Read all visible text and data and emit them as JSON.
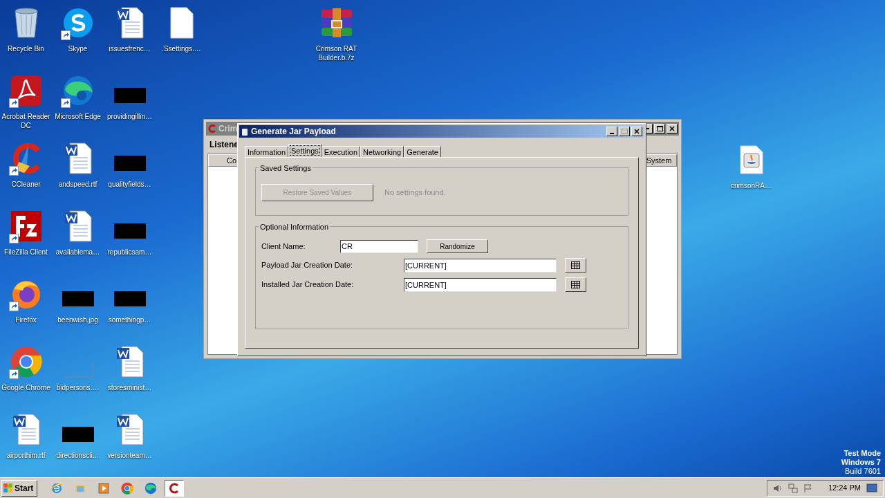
{
  "desktop": {
    "icons": [
      {
        "label": "Recycle Bin",
        "kind": "recycle",
        "shortcut": false
      },
      {
        "label": "Acrobat Reader DC",
        "kind": "pdf",
        "shortcut": true
      },
      {
        "label": "CCleaner",
        "kind": "ccleaner",
        "shortcut": true
      },
      {
        "label": "FileZilla Client",
        "kind": "filezilla",
        "shortcut": true
      },
      {
        "label": "Firefox",
        "kind": "firefox",
        "shortcut": true
      },
      {
        "label": "Google Chrome",
        "kind": "chrome",
        "shortcut": true
      },
      {
        "label": "airporthim.rtf",
        "kind": "word",
        "shortcut": false
      },
      {
        "label": "Skype",
        "kind": "skype",
        "shortcut": true
      },
      {
        "label": "Microsoft Edge",
        "kind": "edge",
        "shortcut": true
      },
      {
        "label": "andspeed.rtf",
        "kind": "word",
        "shortcut": false
      },
      {
        "label": "availablema…",
        "kind": "word",
        "shortcut": false
      },
      {
        "label": "beenwish.jpg",
        "kind": "redacted",
        "shortcut": false
      },
      {
        "label": "bidpersons.…",
        "kind": "thumbnail",
        "shortcut": false
      },
      {
        "label": "directionscli…",
        "kind": "redacted",
        "shortcut": false
      },
      {
        "label": "issuesfrenc…",
        "kind": "word",
        "shortcut": false
      },
      {
        "label": "providingillin…",
        "kind": "redacted",
        "shortcut": false
      },
      {
        "label": "qualityfields…",
        "kind": "redacted",
        "shortcut": false
      },
      {
        "label": "republicsam…",
        "kind": "redacted",
        "shortcut": false
      },
      {
        "label": "somethingp…",
        "kind": "redacted",
        "shortcut": false
      },
      {
        "label": "storesminist…",
        "kind": "word",
        "shortcut": false
      },
      {
        "label": "versionteam…",
        "kind": "word",
        "shortcut": false
      },
      {
        "label": ".Ssettings.…",
        "kind": "blank",
        "shortcut": false
      }
    ],
    "loose_icons": [
      {
        "label": "Crimson RAT Builder.b.7z",
        "kind": "archive",
        "shortcut": false
      },
      {
        "label": "crimsonRA…",
        "kind": "java",
        "shortcut": false
      }
    ]
  },
  "back_window": {
    "title": "Crim",
    "menu": "Listene",
    "columns": [
      "Co",
      "System"
    ]
  },
  "dialog": {
    "title": "Generate Jar Payload",
    "tabs": [
      {
        "label": "Information",
        "selected": false
      },
      {
        "label": "Settings",
        "selected": true
      },
      {
        "label": "Execution",
        "selected": false
      },
      {
        "label": "Networking",
        "selected": false
      },
      {
        "label": "Generate",
        "selected": false
      }
    ],
    "saved_settings": {
      "title": "Saved Settings",
      "button": {
        "label": "Restore Saved Values",
        "disabled": true
      },
      "status": "No settings found."
    },
    "optional_information": {
      "title": "Optional Information",
      "client_name": {
        "label": "Client Name:",
        "value": "CR",
        "button": "Randomize"
      },
      "dates": [
        {
          "label": "Payload Jar Creation Date:",
          "value": "[CURRENT]"
        },
        {
          "label": "Installed Jar Creation Date:",
          "value": "[CURRENT]"
        }
      ]
    }
  },
  "taskbar": {
    "start": "Start",
    "apps": [
      {
        "kind": "ie",
        "selected": false
      },
      {
        "kind": "explorer",
        "selected": false
      },
      {
        "kind": "media",
        "selected": false
      },
      {
        "kind": "chrome",
        "selected": false
      },
      {
        "kind": "edge",
        "selected": false
      },
      {
        "kind": "crimson",
        "selected": true
      }
    ],
    "clock": "12:24 PM"
  },
  "watermark": [
    "Test Mode",
    "Windows 7",
    "Build 7601"
  ]
}
